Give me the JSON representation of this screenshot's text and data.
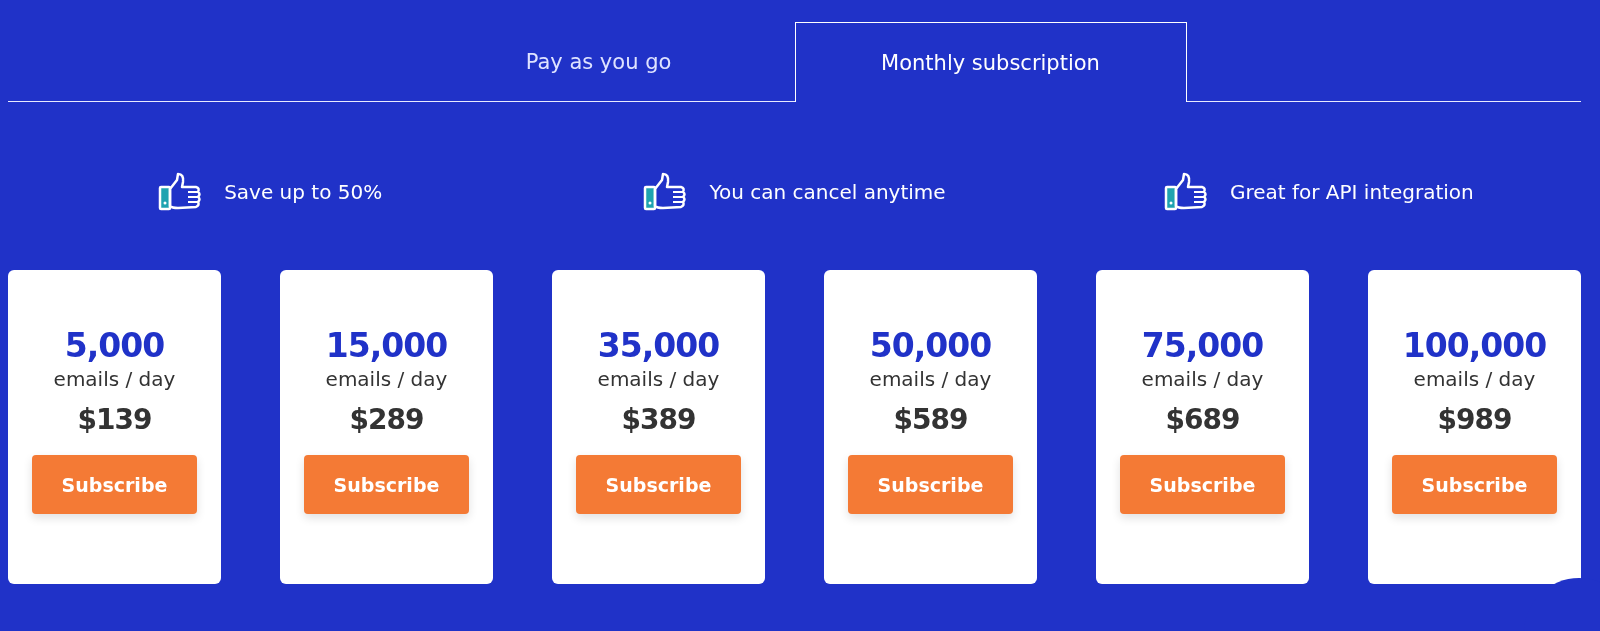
{
  "tabs": [
    {
      "label": "Pay as you go",
      "selected": false
    },
    {
      "label": "Monthly subscription",
      "selected": true
    }
  ],
  "features": [
    {
      "text": "Save up to 50%"
    },
    {
      "text": "You can cancel anytime"
    },
    {
      "text": "Great for API integration"
    }
  ],
  "plans": [
    {
      "volume": "5,000",
      "unit": "emails / day",
      "price": "$139",
      "button": "Subscribe"
    },
    {
      "volume": "15,000",
      "unit": "emails / day",
      "price": "$289",
      "button": "Subscribe"
    },
    {
      "volume": "35,000",
      "unit": "emails / day",
      "price": "$389",
      "button": "Subscribe"
    },
    {
      "volume": "50,000",
      "unit": "emails / day",
      "price": "$589",
      "button": "Subscribe"
    },
    {
      "volume": "75,000",
      "unit": "emails / day",
      "price": "$689",
      "button": "Subscribe"
    },
    {
      "volume": "100,000",
      "unit": "emails / day",
      "price": "$989",
      "button": "Subscribe"
    }
  ]
}
